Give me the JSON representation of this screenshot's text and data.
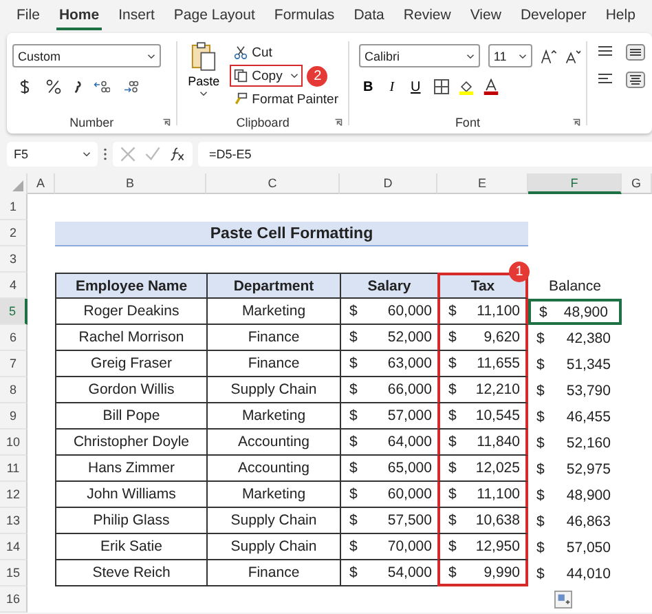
{
  "menu_tabs": [
    {
      "label": "File",
      "selected": false
    },
    {
      "label": "Home",
      "selected": true
    },
    {
      "label": "Insert",
      "selected": false
    },
    {
      "label": "Page Layout",
      "selected": false
    },
    {
      "label": "Formulas",
      "selected": false
    },
    {
      "label": "Data",
      "selected": false
    },
    {
      "label": "Review",
      "selected": false
    },
    {
      "label": "View",
      "selected": false
    },
    {
      "label": "Developer",
      "selected": false
    },
    {
      "label": "Help",
      "selected": false
    }
  ],
  "ribbon": {
    "number": {
      "format": "Custom",
      "label": "Number"
    },
    "clipboard": {
      "paste": "Paste",
      "cut": "Cut",
      "copy": {
        "label": "Copy",
        "outlined": true,
        "badge": "2"
      },
      "format_painter": "Format Painter",
      "label": "Clipboard"
    },
    "font": {
      "family": "Calibri",
      "size": "11",
      "bold": "B",
      "italic": "I",
      "underline": "U",
      "label": "Font"
    }
  },
  "formula_bar": {
    "name_box": "F5",
    "formula": "=D5-E5"
  },
  "sheet": {
    "columns": [
      {
        "label": "A",
        "selected": false
      },
      {
        "label": "B",
        "selected": false
      },
      {
        "label": "C",
        "selected": false
      },
      {
        "label": "D",
        "selected": false
      },
      {
        "label": "E",
        "selected": false
      },
      {
        "label": "F",
        "selected": true
      },
      {
        "label": "G",
        "selected": false
      }
    ],
    "tax_outline": {
      "badge": "1"
    },
    "rows": [
      {
        "number": "1",
        "selected": false,
        "kind": "empty"
      },
      {
        "number": "2",
        "selected": false,
        "kind": "title",
        "title": "Paste Cell Formatting"
      },
      {
        "number": "3",
        "selected": false,
        "kind": "empty"
      },
      {
        "number": "4",
        "selected": false,
        "kind": "header",
        "headers": [
          "Employee Name",
          "Department",
          "Salary",
          "Tax"
        ],
        "extra": "Balance"
      },
      {
        "number": "5",
        "selected": true,
        "kind": "data",
        "name": "Roger Deakins",
        "department": "Marketing",
        "salary": {
          "symbol": "$",
          "value": "60,000"
        },
        "tax": {
          "symbol": "$",
          "value": "11,100"
        },
        "balance": {
          "symbol": "$",
          "value": "48,900",
          "selected": true
        }
      },
      {
        "number": "6",
        "selected": false,
        "kind": "data",
        "name": "Rachel Morrison",
        "department": "Finance",
        "salary": {
          "symbol": "$",
          "value": "52,000"
        },
        "tax": {
          "symbol": "$",
          "value": "9,620"
        },
        "balance": {
          "symbol": "$",
          "value": "42,380",
          "selected": false
        }
      },
      {
        "number": "7",
        "selected": false,
        "kind": "data",
        "name": "Greig Fraser",
        "department": "Finance",
        "salary": {
          "symbol": "$",
          "value": "63,000"
        },
        "tax": {
          "symbol": "$",
          "value": "11,655"
        },
        "balance": {
          "symbol": "$",
          "value": "51,345",
          "selected": false
        }
      },
      {
        "number": "8",
        "selected": false,
        "kind": "data",
        "name": "Gordon Willis",
        "department": "Supply Chain",
        "salary": {
          "symbol": "$",
          "value": "66,000"
        },
        "tax": {
          "symbol": "$",
          "value": "12,210"
        },
        "balance": {
          "symbol": "$",
          "value": "53,790",
          "selected": false
        }
      },
      {
        "number": "9",
        "selected": false,
        "kind": "data",
        "name": "Bill Pope",
        "department": "Marketing",
        "salary": {
          "symbol": "$",
          "value": "57,000"
        },
        "tax": {
          "symbol": "$",
          "value": "10,545"
        },
        "balance": {
          "symbol": "$",
          "value": "46,455",
          "selected": false
        }
      },
      {
        "number": "10",
        "selected": false,
        "kind": "data",
        "name": "Christopher Doyle",
        "department": "Accounting",
        "salary": {
          "symbol": "$",
          "value": "64,000"
        },
        "tax": {
          "symbol": "$",
          "value": "11,840"
        },
        "balance": {
          "symbol": "$",
          "value": "52,160",
          "selected": false
        }
      },
      {
        "number": "11",
        "selected": false,
        "kind": "data",
        "name": "Hans Zimmer",
        "department": "Accounting",
        "salary": {
          "symbol": "$",
          "value": "65,000"
        },
        "tax": {
          "symbol": "$",
          "value": "12,025"
        },
        "balance": {
          "symbol": "$",
          "value": "52,975",
          "selected": false
        }
      },
      {
        "number": "12",
        "selected": false,
        "kind": "data",
        "name": "John Williams",
        "department": "Marketing",
        "salary": {
          "symbol": "$",
          "value": "60,000"
        },
        "tax": {
          "symbol": "$",
          "value": "11,100"
        },
        "balance": {
          "symbol": "$",
          "value": "48,900",
          "selected": false
        }
      },
      {
        "number": "13",
        "selected": false,
        "kind": "data",
        "name": "Philip Glass",
        "department": "Supply Chain",
        "salary": {
          "symbol": "$",
          "value": "57,500"
        },
        "tax": {
          "symbol": "$",
          "value": "10,638"
        },
        "balance": {
          "symbol": "$",
          "value": "46,863",
          "selected": false
        }
      },
      {
        "number": "14",
        "selected": false,
        "kind": "data",
        "name": "Erik Satie",
        "department": "Supply Chain",
        "salary": {
          "symbol": "$",
          "value": "70,000"
        },
        "tax": {
          "symbol": "$",
          "value": "12,950"
        },
        "balance": {
          "symbol": "$",
          "value": "57,050",
          "selected": false
        }
      },
      {
        "number": "15",
        "selected": false,
        "kind": "data",
        "name": "Steve Reich",
        "department": "Finance",
        "salary": {
          "symbol": "$",
          "value": "54,000"
        },
        "tax": {
          "symbol": "$",
          "value": "9,990"
        },
        "balance": {
          "symbol": "$",
          "value": "44,010",
          "selected": false
        }
      },
      {
        "number": "16",
        "selected": false,
        "kind": "empty"
      }
    ]
  }
}
